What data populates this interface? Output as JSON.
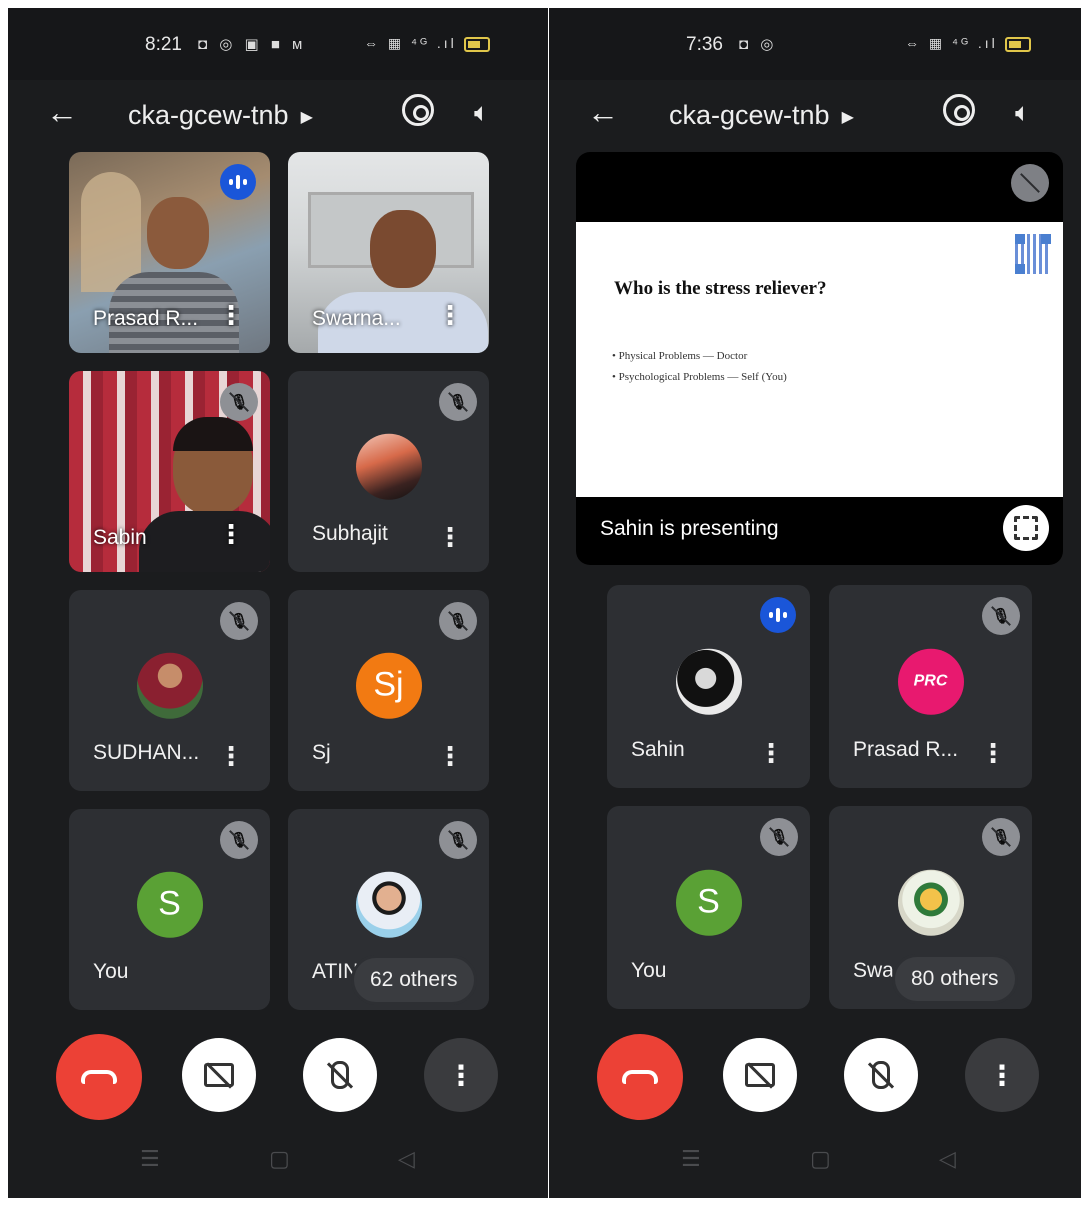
{
  "left": {
    "status": {
      "time": "8:21",
      "left_icons": "◘ ◎ ▣ ■ ᴍ",
      "right_icons": "⇔ ▦ ⁴ᴳ .ıl"
    },
    "meeting_code": "cka-gcew-tnb",
    "tiles": [
      {
        "name": "Prasad R...",
        "speaking": true
      },
      {
        "name": "Swarna..."
      },
      {
        "name": "Sabin"
      },
      {
        "name": "Subhajit"
      },
      {
        "name": "SUDHAN..."
      },
      {
        "name": "Sj",
        "initials": "Sj"
      },
      {
        "name": "You",
        "initials": "S"
      },
      {
        "name": "ATIN"
      }
    ],
    "others": "62 others"
  },
  "right": {
    "status": {
      "time": "7:36",
      "left_icons": "◘ ◎",
      "right_icons": "⇔ ▦ ⁴ᴳ .ıl"
    },
    "meeting_code": "cka-gcew-tnb",
    "presentation": {
      "slide_title": "Who is the stress reliever?",
      "bullets": [
        "• Physical Problems — Doctor",
        "• Psychological Problems — Self (You)"
      ],
      "presenting_text": "Sahin is presenting"
    },
    "tiles": [
      {
        "name": "Sahin",
        "speaking": true
      },
      {
        "name": "Prasad R...",
        "avatar_text": "PRC"
      },
      {
        "name": "You",
        "initials": "S"
      },
      {
        "name": "Swa"
      }
    ],
    "others": "80 others"
  },
  "colors": {
    "end_call": "#ec4136",
    "speaking": "#1a56d9",
    "you_avatar": "#5aa135",
    "sj_avatar": "#f27a12",
    "prc_avatar": "#e8196f"
  },
  "icons": [
    "back-arrow-icon",
    "camera-flip-icon",
    "speaker-icon",
    "mic-off-icon",
    "video-off-icon",
    "end-call-icon",
    "more-vert-icon",
    "fullscreen-icon"
  ]
}
